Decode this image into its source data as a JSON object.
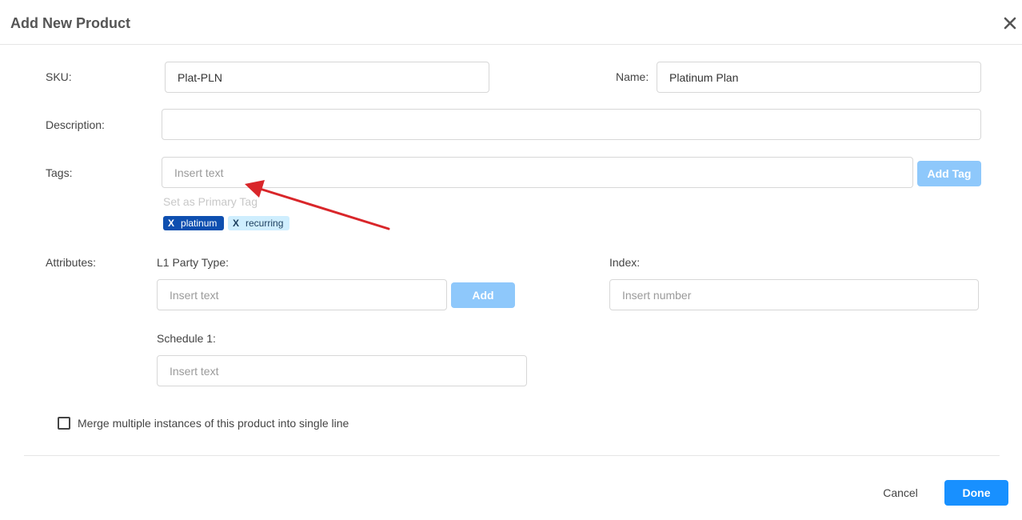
{
  "dialog": {
    "title": "Add New Product"
  },
  "icons": {
    "close": "close-icon"
  },
  "form": {
    "sku": {
      "label": "SKU:",
      "value": "Plat-PLN"
    },
    "name": {
      "label": "Name:",
      "value": "Platinum Plan"
    },
    "description": {
      "label": "Description:",
      "value": ""
    },
    "tags": {
      "label": "Tags:",
      "placeholder": "Insert text",
      "add_button": "Add Tag",
      "primary_hint": "Set as Primary Tag",
      "items": [
        {
          "remove": "X",
          "text": "platinum",
          "primary": true
        },
        {
          "remove": "X",
          "text": "recurring",
          "primary": false
        }
      ]
    },
    "attributes": {
      "label": "Attributes:",
      "l1_party_type": {
        "label": "L1 Party Type:",
        "placeholder": "Insert text",
        "add_button": "Add"
      },
      "index": {
        "label": "Index:",
        "placeholder": "Insert number"
      },
      "schedule_1": {
        "label": "Schedule 1:",
        "placeholder": "Insert text"
      }
    },
    "merge_checkbox": {
      "label": "Merge multiple instances of this product into single line",
      "checked": false
    }
  },
  "footer": {
    "cancel": "Cancel",
    "done": "Done"
  },
  "colors": {
    "primary": "#1890ff",
    "disabled_button": "#8ec8fb",
    "primary_tag": "#0e4fb0",
    "secondary_tag": "#cfeefe",
    "annotation_arrow": "#d9262a"
  }
}
